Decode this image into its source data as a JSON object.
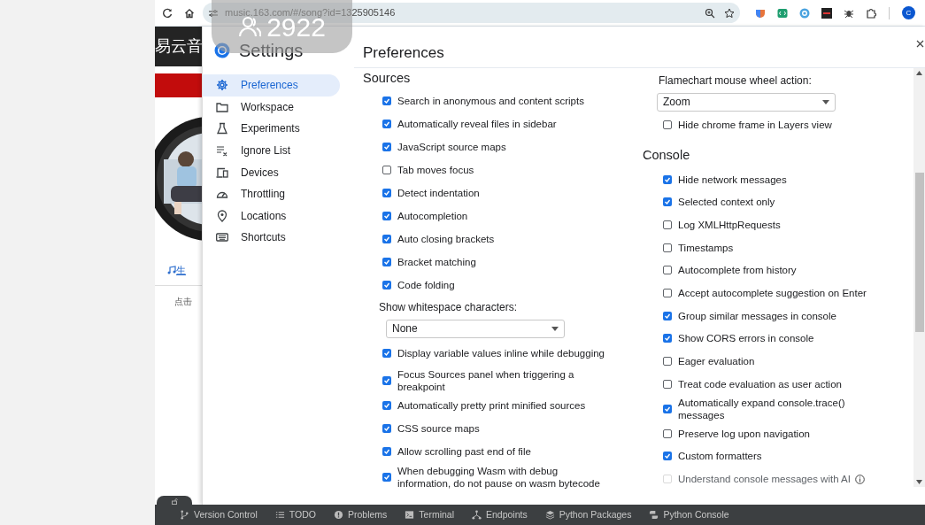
{
  "browser": {
    "url": "music.163.com/#/song?id=1325905146",
    "profile_initial": "C"
  },
  "overlay": {
    "count": "2922"
  },
  "page_strip": {
    "header_text": "易云音",
    "link_text": "生",
    "hint_text": "点击"
  },
  "settings": {
    "title": "Settings",
    "content_title": "Preferences",
    "sidebar": {
      "items": [
        {
          "label": "Preferences",
          "selected": true
        },
        {
          "label": "Workspace",
          "selected": false
        },
        {
          "label": "Experiments",
          "selected": false
        },
        {
          "label": "Ignore List",
          "selected": false
        },
        {
          "label": "Devices",
          "selected": false
        },
        {
          "label": "Throttling",
          "selected": false
        },
        {
          "label": "Locations",
          "selected": false
        },
        {
          "label": "Shortcuts",
          "selected": false
        }
      ]
    },
    "left_column": [
      {
        "kind": "heading",
        "text": "Sources"
      },
      {
        "kind": "checkbox",
        "label": "Search in anonymous and content scripts",
        "checked": true,
        "disabled": false,
        "info": false
      },
      {
        "kind": "checkbox",
        "label": "Automatically reveal files in sidebar",
        "checked": true,
        "disabled": false,
        "info": false
      },
      {
        "kind": "checkbox",
        "label": "JavaScript source maps",
        "checked": true,
        "disabled": false,
        "info": false
      },
      {
        "kind": "checkbox",
        "label": "Tab moves focus",
        "checked": false,
        "disabled": false,
        "info": false
      },
      {
        "kind": "checkbox",
        "label": "Detect indentation",
        "checked": true,
        "disabled": false,
        "info": false
      },
      {
        "kind": "checkbox",
        "label": "Autocompletion",
        "checked": true,
        "disabled": false,
        "info": false
      },
      {
        "kind": "checkbox",
        "label": "Auto closing brackets",
        "checked": true,
        "disabled": false,
        "info": false
      },
      {
        "kind": "checkbox",
        "label": "Bracket matching",
        "checked": true,
        "disabled": false,
        "info": false
      },
      {
        "kind": "checkbox",
        "label": "Code folding",
        "checked": true,
        "disabled": false,
        "info": false
      },
      {
        "kind": "label",
        "text": "Show whitespace characters:"
      },
      {
        "kind": "select",
        "value": "None"
      },
      {
        "kind": "checkbox",
        "label": "Display variable values inline while debugging",
        "checked": true,
        "disabled": false,
        "info": false
      },
      {
        "kind": "checkbox",
        "label": "Focus Sources panel when triggering a breakpoint",
        "checked": true,
        "disabled": false,
        "info": false
      },
      {
        "kind": "checkbox",
        "label": "Automatically pretty print minified sources",
        "checked": true,
        "disabled": false,
        "info": false
      },
      {
        "kind": "checkbox",
        "label": "CSS source maps",
        "checked": true,
        "disabled": false,
        "info": false
      },
      {
        "kind": "checkbox",
        "label": "Allow scrolling past end of file",
        "checked": true,
        "disabled": false,
        "info": false
      },
      {
        "kind": "checkbox",
        "label": "When debugging Wasm with debug information, do not pause on wasm bytecode",
        "checked": true,
        "disabled": false,
        "info": false
      }
    ],
    "right_column": [
      {
        "kind": "label",
        "text": "Flamechart mouse wheel action:"
      },
      {
        "kind": "select",
        "value": "Zoom"
      },
      {
        "kind": "checkbox",
        "label": "Hide chrome frame in Layers view",
        "checked": false,
        "disabled": false,
        "info": false
      },
      {
        "kind": "heading",
        "text": "Console"
      },
      {
        "kind": "checkbox",
        "label": "Hide network messages",
        "checked": true,
        "disabled": false,
        "info": false
      },
      {
        "kind": "checkbox",
        "label": "Selected context only",
        "checked": true,
        "disabled": false,
        "info": false
      },
      {
        "kind": "checkbox",
        "label": "Log XMLHttpRequests",
        "checked": false,
        "disabled": false,
        "info": false
      },
      {
        "kind": "checkbox",
        "label": "Timestamps",
        "checked": false,
        "disabled": false,
        "info": false
      },
      {
        "kind": "checkbox",
        "label": "Autocomplete from history",
        "checked": false,
        "disabled": false,
        "info": false
      },
      {
        "kind": "checkbox",
        "label": "Accept autocomplete suggestion on Enter",
        "checked": false,
        "disabled": false,
        "info": false
      },
      {
        "kind": "checkbox",
        "label": "Group similar messages in console",
        "checked": true,
        "disabled": false,
        "info": false
      },
      {
        "kind": "checkbox",
        "label": "Show CORS errors in console",
        "checked": true,
        "disabled": false,
        "info": false
      },
      {
        "kind": "checkbox",
        "label": "Eager evaluation",
        "checked": false,
        "disabled": false,
        "info": false
      },
      {
        "kind": "checkbox",
        "label": "Treat code evaluation as user action",
        "checked": false,
        "disabled": false,
        "info": false
      },
      {
        "kind": "checkbox",
        "label": "Automatically expand console.trace() messages",
        "checked": true,
        "disabled": false,
        "info": false
      },
      {
        "kind": "checkbox",
        "label": "Preserve log upon navigation",
        "checked": false,
        "disabled": false,
        "info": false
      },
      {
        "kind": "checkbox",
        "label": "Custom formatters",
        "checked": true,
        "disabled": false,
        "info": false
      },
      {
        "kind": "checkbox",
        "label": "Understand console messages with AI",
        "checked": false,
        "disabled": true,
        "info": true
      }
    ]
  },
  "tool_bar": {
    "items": [
      "Version Control",
      "TODO",
      "Problems",
      "Terminal",
      "Endpoints",
      "Python Packages",
      "Python Console"
    ]
  }
}
